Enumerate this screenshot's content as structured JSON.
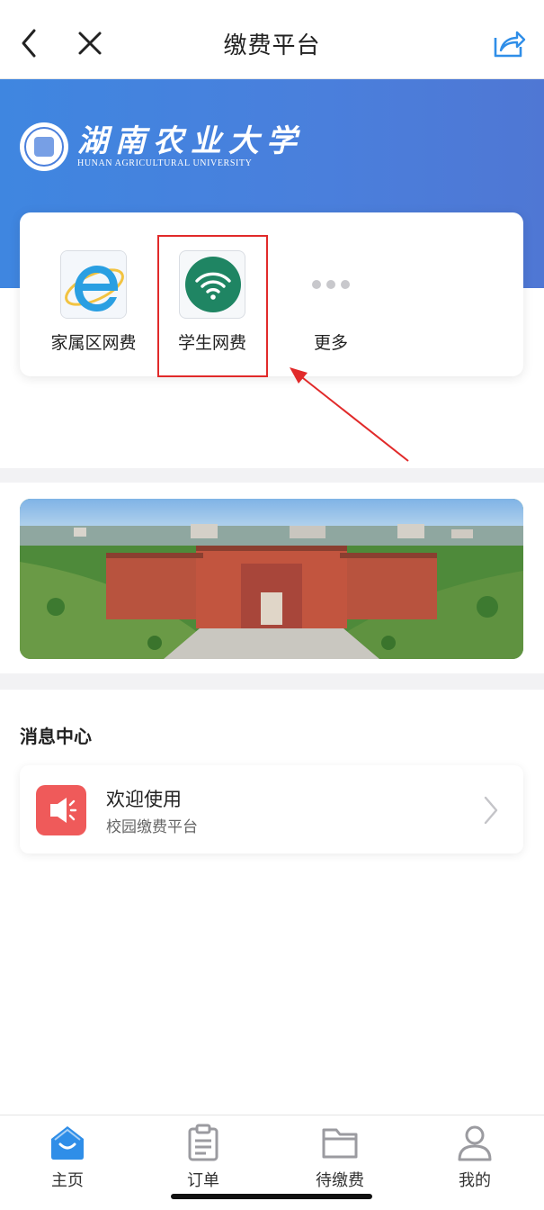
{
  "header": {
    "title": "缴费平台",
    "back_icon": "chevron-left-icon",
    "close_icon": "close-icon",
    "share_icon": "share-icon"
  },
  "banner": {
    "logo_cn": "湖南农业大学",
    "logo_en": "HUNAN AGRICULTURAL UNIVERSITY",
    "accent_color": "#4a7fdc"
  },
  "services": [
    {
      "label": "家属区网费",
      "icon": "ie-browser-icon"
    },
    {
      "label": "学生网费",
      "icon": "wifi-icon",
      "highlighted": true
    },
    {
      "label": "更多",
      "icon": "more-dots-icon"
    }
  ],
  "campus_banner": {
    "description_icon": "campus-photo"
  },
  "messages": {
    "section_title": "消息中心",
    "items": [
      {
        "title": "欢迎使用",
        "subtitle": "校园缴费平台",
        "icon": "speaker-icon",
        "icon_color": "#ef5a5a"
      }
    ]
  },
  "bottom_nav": [
    {
      "label": "主页",
      "icon": "home-icon",
      "active": true
    },
    {
      "label": "订单",
      "icon": "clipboard-icon"
    },
    {
      "label": "待缴费",
      "icon": "folder-icon"
    },
    {
      "label": "我的",
      "icon": "user-icon"
    }
  ],
  "colors": {
    "highlight_red": "#e12a2a",
    "active_blue": "#2f8ee8",
    "wifi_green": "#1f8563"
  }
}
